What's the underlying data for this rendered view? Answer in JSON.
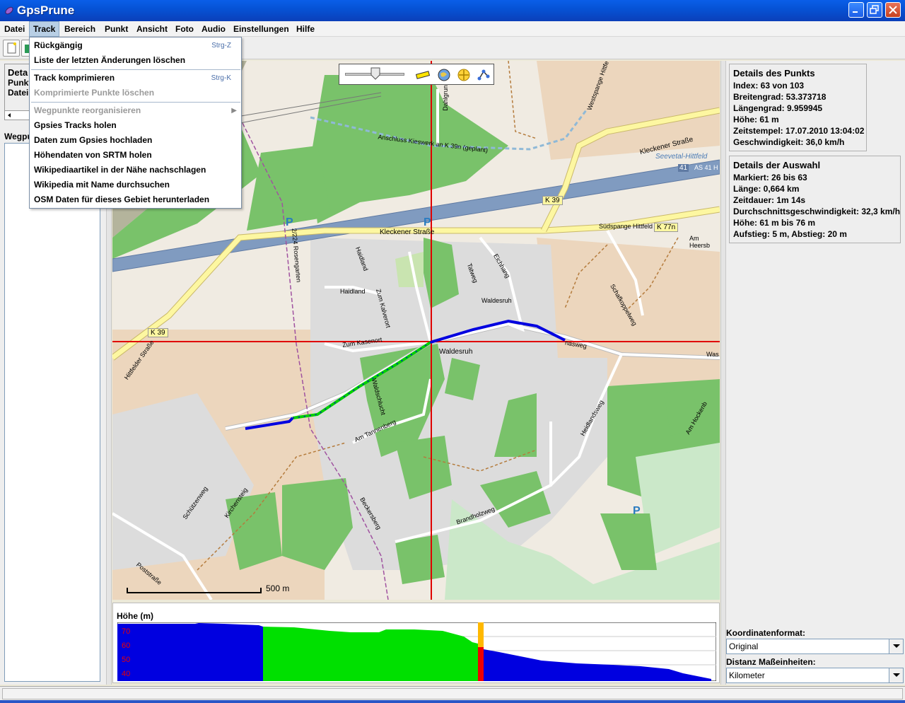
{
  "window": {
    "title": "GpsPrune"
  },
  "menubar": {
    "items": [
      {
        "label": "Datei"
      },
      {
        "label": "Track"
      },
      {
        "label": "Bereich"
      },
      {
        "label": "Punkt"
      },
      {
        "label": "Ansicht"
      },
      {
        "label": "Foto"
      },
      {
        "label": "Audio"
      },
      {
        "label": "Einstellungen"
      },
      {
        "label": "Hilfe"
      }
    ]
  },
  "track_menu": {
    "items": [
      {
        "label": "Rückgängig",
        "shortcut": "Strg-Z",
        "enabled": true
      },
      {
        "label": "Liste der letzten Änderungen löschen",
        "shortcut": "",
        "enabled": true
      },
      {
        "label": "Track komprimieren",
        "shortcut": "Strg-K",
        "enabled": true
      },
      {
        "label": "Komprimierte Punkte löschen",
        "shortcut": "",
        "enabled": false
      },
      {
        "label": "Wegpunkte reorganisieren",
        "shortcut": "",
        "enabled": false
      },
      {
        "label": "Gpsies Tracks holen",
        "shortcut": "",
        "enabled": true
      },
      {
        "label": "Daten zum Gpsies hochladen",
        "shortcut": "",
        "enabled": true
      },
      {
        "label": "Höhendaten von SRTM holen",
        "shortcut": "",
        "enabled": true
      },
      {
        "label": "Wikipediaartikel in der Nähe nachschlagen",
        "shortcut": "",
        "enabled": true
      },
      {
        "label": "Wikipedia mit Name durchsuchen",
        "shortcut": "",
        "enabled": true
      },
      {
        "label": "OSM Daten für dieses Gebiet herunterladen",
        "shortcut": "",
        "enabled": true
      }
    ]
  },
  "left_panel": {
    "details_heading": "Deta",
    "row1": "Punkt",
    "row2": "Datei:",
    "waypoints_label": "Wegpu"
  },
  "map": {
    "scale_label": "500 m",
    "labels": {
      "k39_a": "K 39",
      "k39_b": "K 39",
      "k77n": "K 77n",
      "a41": "41",
      "seevetal": "Seevetal-Hittfeld",
      "as41": "AS 41 H",
      "kleckener1": "Kleckener Straße",
      "kleckener2": "Kleckener Straße",
      "anschluss": "Anschluss Kieswerk an K 39n (geplant)",
      "suedspange": "Südspange Hittfeld",
      "am_heers": "Am Heersb",
      "waldesruh": "Waldesruh",
      "waldesruh2": "Waldesruh",
      "zum_kasenort": "Zum Kasenort",
      "haidland": "Haidland",
      "haidland2": "Haidland",
      "tatweg": "Tatweg",
      "eichhang": "Eichhang",
      "schafkoppel": "Schafkoppelweg",
      "heidlandsweg": "Heidlandsweg",
      "rosengarten": "2/224 Rosengarten",
      "hittfelder": "Hittfelder Straße",
      "tannenberg": "Am Tannenberg",
      "schuetzenweg": "Schützenweg",
      "kirchensteig": "Kirchensteig",
      "brandholzweg": "Brandholzweg",
      "beckersberg": "Beckersberg",
      "poststrasse": "Poststraße",
      "am_hocken": "Am Hockenb",
      "westspange": "Westspange Hittfe",
      "dahlgrund": "Dahlgrund",
      "waldschlucht": "Waldschlucht",
      "was": "Was",
      "zum_kalvarort": "Zum Kalverort",
      "kasweg": "nasweg",
      "parking": "P"
    }
  },
  "profile": {
    "title": "Höhe (m)",
    "ticks": [
      "70",
      "60",
      "50",
      "40"
    ]
  },
  "point_details": {
    "heading": "Details des Punkts",
    "index": "Index: 63 von 103",
    "lat": "Breitengrad: 53.373718",
    "lon": "Längengrad: 9.959945",
    "alt": "Höhe: 61 m",
    "time": "Zeitstempel: 17.07.2010 13:04:02",
    "speed": "Geschwindigkeit: 36,0 km/h"
  },
  "selection_details": {
    "heading": "Details der Auswahl",
    "marked": "Markiert: 26 bis 63",
    "length": "Länge: 0,664 km",
    "duration": "Zeitdauer: 1m 14s",
    "avg_speed": "Durchschnittsgeschwindigkeit: 32,3 km/h",
    "alt_range": "Höhe: 61 m bis 76 m",
    "climb": "Aufstieg: 5 m, Abstieg: 20 m"
  },
  "settings": {
    "coord_label": "Koordinatenformat:",
    "coord_value": "Original",
    "dist_label": "Distanz Maßeinheiten:",
    "dist_value": "Kilometer"
  },
  "colors": {
    "track": "#0000e0",
    "selection": "#00e000",
    "crosshair": "#e00000",
    "forest": "#79c26a",
    "residential": "#dcdcdc",
    "farmland": "#ecd6bd"
  }
}
